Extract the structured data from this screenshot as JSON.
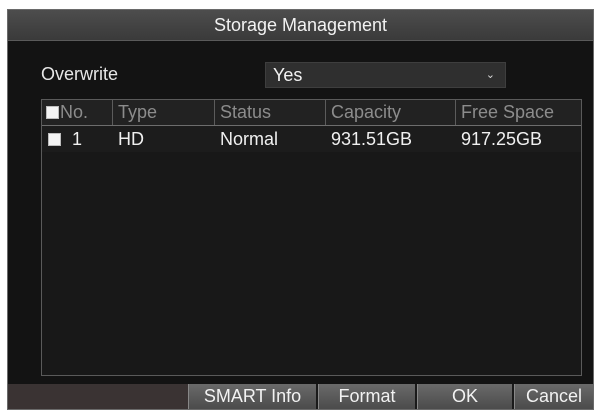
{
  "window": {
    "title": "Storage Management"
  },
  "overwrite": {
    "label": "Overwrite",
    "value": "Yes",
    "arrow_icon": "chevron-down-icon"
  },
  "table": {
    "columns": [
      "No.",
      "Type",
      "Status",
      "Capacity",
      "Free Space"
    ],
    "rows": [
      {
        "no": "1",
        "type": "HD",
        "status": "Normal",
        "capacity": "931.51GB",
        "free_space": "917.25GB",
        "checked": false
      }
    ]
  },
  "buttons": {
    "smart_info": "SMART Info",
    "format": "Format",
    "ok": "OK",
    "cancel": "Cancel"
  }
}
